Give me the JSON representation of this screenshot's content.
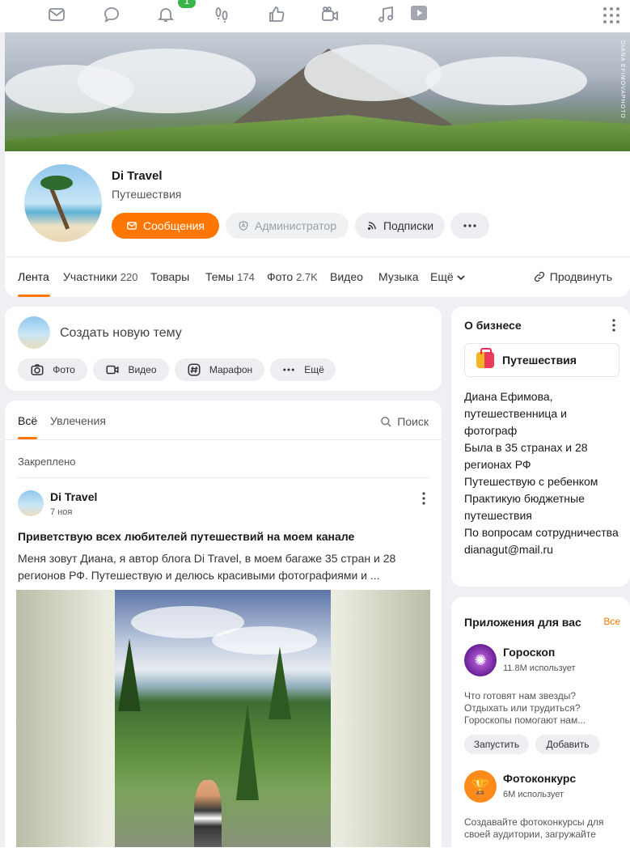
{
  "topnav": {
    "icons": [
      "mail-icon",
      "chat-icon",
      "bell-icon",
      "footprints-icon",
      "like-icon",
      "video-camera-icon",
      "music-note-icon",
      "play-icon",
      "apps-grid-icon"
    ],
    "notification_count": "1"
  },
  "cover": {
    "watermark": "DIANA EFIMOVAPHOTO"
  },
  "profile": {
    "name": "Di Travel",
    "category": "Путешествия",
    "buttons": {
      "messages": "Сообщения",
      "admin": "Администратор",
      "subscriptions": "Подписки"
    },
    "tabs": [
      {
        "label": "Лента",
        "count": ""
      },
      {
        "label": "Участники",
        "count": "220"
      },
      {
        "label": "Товары",
        "count": ""
      },
      {
        "label": "Темы",
        "count": "174"
      },
      {
        "label": "Фото",
        "count": "2.7K"
      },
      {
        "label": "Видео",
        "count": ""
      },
      {
        "label": "Музыка",
        "count": ""
      },
      {
        "label": "Ещё",
        "count": ""
      }
    ],
    "promote": "Продвинуть"
  },
  "create": {
    "placeholder": "Создать новую тему",
    "chips": [
      "Фото",
      "Видео",
      "Марафон",
      "Ещё"
    ]
  },
  "feed": {
    "tabs": [
      "Всё",
      "Увлечения"
    ],
    "search": "Поиск",
    "pinned": "Закреплено",
    "post": {
      "author": "Di Travel",
      "date": "7 ноя",
      "title": "Приветствую всех любителей путешествий на моем канале",
      "text": "Меня зовут Диана, я автор блога Di Travel, в моем багаже 35 стран и 28 регионов РФ. Путешествую и делюсь красивыми фотографиями и ..."
    }
  },
  "business": {
    "heading": "О бизнесе",
    "category": "Путешествия",
    "description": [
      "Диана Ефимова, путешественница и фотограф",
      "Была в 35 странах и 28 регионах РФ",
      "Путешествую с ребенком",
      "Практикую бюджетные путешествия",
      "По вопросам сотрудничества",
      "dianagut@mail.ru"
    ]
  },
  "apps": {
    "heading": "Приложения для вас",
    "all": "Все",
    "items": [
      {
        "name": "Гороскоп",
        "users": "11.8M использует",
        "desc": "Что готовят нам звезды? Отдыхать или трудиться? Гороскопы помогают нам...",
        "launch": "Запустить",
        "add": "Добавить",
        "color": "#6a1f96"
      },
      {
        "name": "Фотоконкурс",
        "users": "6M использует",
        "desc": "Создавайте фотоконкурсы для своей аудитории, загружайте",
        "color": "#ff8a1c"
      }
    ]
  },
  "colors": {
    "accent": "#ff7700",
    "background": "#eef0f3"
  }
}
